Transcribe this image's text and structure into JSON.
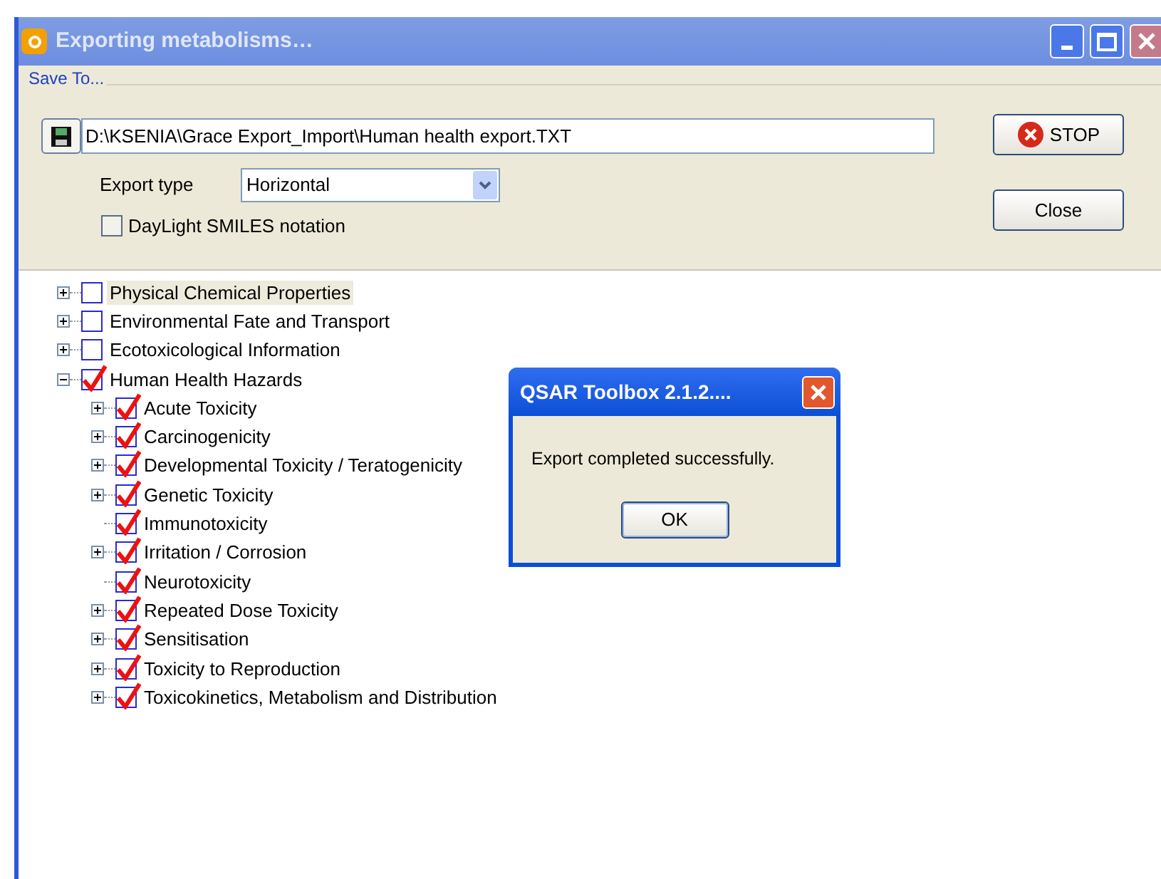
{
  "window": {
    "title": "Exporting metabolisms…"
  },
  "save_to": {
    "label": "Save To...",
    "path": "D:\\KSENIA\\Grace Export_Import\\Human health export.TXT"
  },
  "export_type": {
    "label": "Export type",
    "value": "Horizontal"
  },
  "smiles_option": {
    "label": "DayLight SMILES notation",
    "checked": false
  },
  "buttons": [
    {
      "label": "STOP",
      "kind": "stop"
    },
    {
      "label": "Close",
      "kind": "plain"
    }
  ],
  "tree": [
    {
      "label": "Physical Chemical Properties",
      "checked": false,
      "selected": true,
      "kind": "branch",
      "expanded": false
    },
    {
      "label": "Environmental Fate and Transport",
      "checked": false,
      "selected": false,
      "kind": "branch",
      "expanded": false
    },
    {
      "label": "Ecotoxicological Information",
      "checked": false,
      "selected": false,
      "kind": "branch",
      "expanded": false
    },
    {
      "label": "Human Health Hazards",
      "checked": true,
      "selected": false,
      "kind": "branch",
      "expanded": true,
      "children": [
        {
          "label": "Acute Toxicity",
          "checked": true,
          "selected": false,
          "kind": "branch",
          "expanded": false
        },
        {
          "label": "Carcinogenicity",
          "checked": true,
          "selected": false,
          "kind": "branch",
          "expanded": false
        },
        {
          "label": "Developmental Toxicity / Teratogenicity",
          "checked": true,
          "selected": false,
          "kind": "branch",
          "expanded": false
        },
        {
          "label": "Genetic Toxicity",
          "checked": true,
          "selected": false,
          "kind": "branch",
          "expanded": false
        },
        {
          "label": "Immunotoxicity",
          "checked": true,
          "selected": false,
          "kind": "leaf"
        },
        {
          "label": "Irritation / Corrosion",
          "checked": true,
          "selected": false,
          "kind": "branch",
          "expanded": false
        },
        {
          "label": "Neurotoxicity",
          "checked": true,
          "selected": false,
          "kind": "leaf"
        },
        {
          "label": "Repeated Dose Toxicity",
          "checked": true,
          "selected": false,
          "kind": "branch",
          "expanded": false
        },
        {
          "label": "Sensitisation",
          "checked": true,
          "selected": false,
          "kind": "branch",
          "expanded": false
        },
        {
          "label": "Toxicity to Reproduction",
          "checked": true,
          "selected": false,
          "kind": "branch",
          "expanded": false
        },
        {
          "label": "Toxicokinetics, Metabolism and Distribution",
          "checked": true,
          "selected": false,
          "kind": "branch",
          "expanded": false
        }
      ]
    }
  ],
  "dialog": {
    "title": "QSAR Toolbox 2.1.2....",
    "message": "Export completed successfully.",
    "button": "OK"
  }
}
